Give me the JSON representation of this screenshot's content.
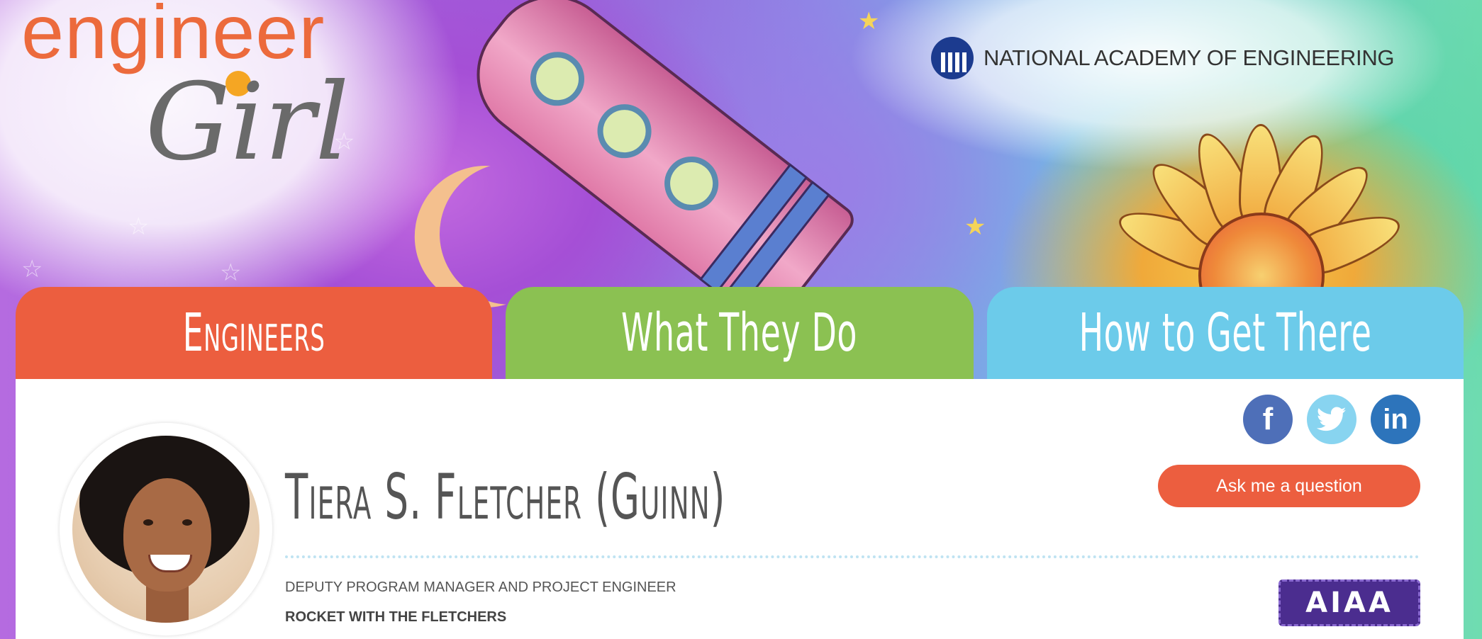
{
  "header": {
    "logo_line1": "engineer",
    "logo_line2": "Girl",
    "partner": "NATIONAL ACADEMY OF ENGINEERING"
  },
  "nav": {
    "tabs": [
      {
        "label": "Engineers",
        "color": "#ec5e3f"
      },
      {
        "label": "What They Do",
        "color": "#8bc152"
      },
      {
        "label": "How to Get There",
        "color": "#6ccbea"
      }
    ]
  },
  "social": {
    "facebook": "f",
    "twitter": "twitter-bird-icon",
    "linkedin": "in"
  },
  "profile": {
    "name": "Tiera S. Fletcher (Guinn)",
    "title": "DEPUTY PROGRAM MANAGER AND PROJECT ENGINEER",
    "organization": "ROCKET WITH THE FLETCHERS",
    "badge": "AIAA",
    "ask_button": "Ask me a question"
  },
  "colors": {
    "accent_orange": "#ec5e3f",
    "accent_green": "#8bc152",
    "accent_blue": "#6ccbea",
    "badge_purple": "#4b2d8f"
  }
}
